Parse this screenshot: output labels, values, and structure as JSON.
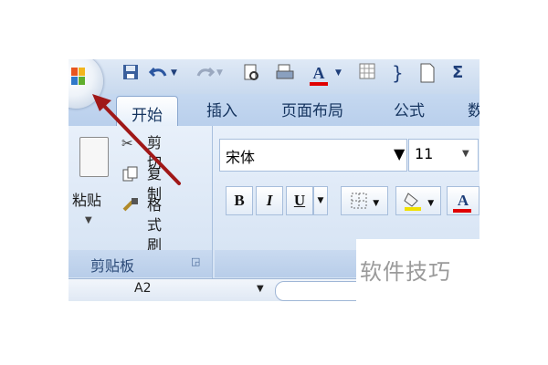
{
  "tabs": {
    "active": "开始",
    "items": [
      "插入",
      "页面布局",
      "公式",
      "数"
    ]
  },
  "clipboard": {
    "group_label": "剪贴板",
    "paste_label": "粘贴",
    "cut_label": "剪切",
    "copy_label": "复制",
    "format_painter_label": "格式刷"
  },
  "font": {
    "name": "宋体",
    "size": "11",
    "bold": "B",
    "italic": "I",
    "underline": "U",
    "font_color_glyph": "A"
  },
  "quick_access": {
    "undo_icon": "undo-icon",
    "redo_icon": "redo-icon",
    "font_color_glyph": "A",
    "sum_glyph": "Σ"
  },
  "formula_bar": {
    "cell_ref": "A2"
  },
  "watermark": "软件技巧",
  "colors": {
    "arrow": "#a01818",
    "font_color_bar": "#e00000",
    "highlight_bar": "#f0e000"
  }
}
